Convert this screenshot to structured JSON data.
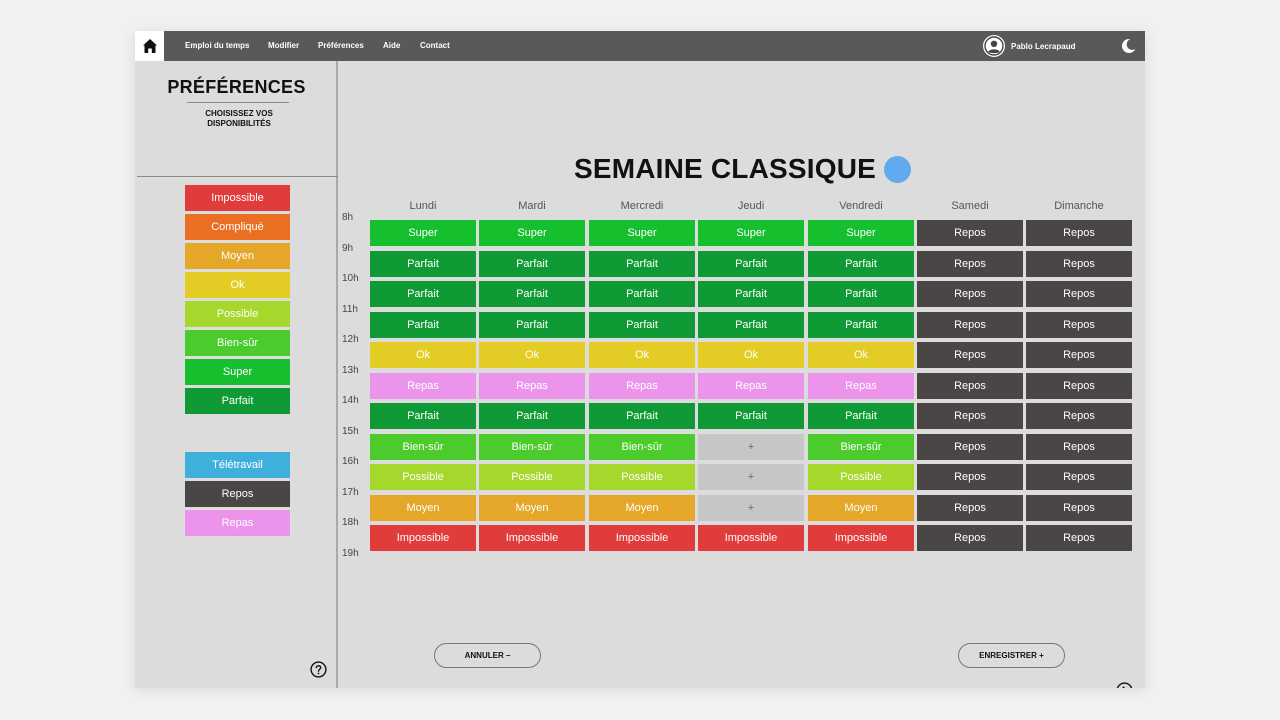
{
  "nav": {
    "links": [
      "Emploi du temps",
      "Modifier",
      "Préférences",
      "Aide",
      "Contact"
    ],
    "user_name": "Pablo Lecrapaud"
  },
  "sidebar": {
    "title": "PRÉFÉRENCES",
    "subtitle": "CHOISISSEZ VOS DISPONIBILITÉS",
    "levels": [
      {
        "label": "Impossible",
        "color": "#e03c3c"
      },
      {
        "label": "Compliqué",
        "color": "#ea6f23"
      },
      {
        "label": "Moyen",
        "color": "#e4a72a"
      },
      {
        "label": "Ok",
        "color": "#e3cd25"
      },
      {
        "label": "Possible",
        "color": "#a6d72d"
      },
      {
        "label": "Bien-sûr",
        "color": "#4ccc2c"
      },
      {
        "label": "Super",
        "color": "#15bf2e"
      },
      {
        "label": "Parfait",
        "color": "#0f9a35"
      }
    ],
    "special": [
      {
        "label": "Télétravail",
        "color": "#3fb0dc"
      },
      {
        "label": "Repos",
        "color": "#4a4646"
      },
      {
        "label": "Repas",
        "color": "#ec93ec"
      }
    ]
  },
  "week": {
    "title": "SEMAINE CLASSIQUE",
    "days": [
      "Lundi",
      "Mardi",
      "Mercredi",
      "Jeudi",
      "Vendredi",
      "Samedi",
      "Dimanche"
    ],
    "hours": [
      "8h",
      "9h",
      "10h",
      "11h",
      "12h",
      "13h",
      "14h",
      "15h",
      "16h",
      "17h",
      "18h",
      "19h"
    ],
    "colors": {
      "Super": "#15bf2e",
      "Parfait": "#0f9a35",
      "Ok": "#e3cd25",
      "Repas": "#ec93ec",
      "Bien-sûr": "#4ccc2c",
      "Possible": "#a6d72d",
      "Moyen": "#e4a72a",
      "Impossible": "#e03c3c",
      "Repos": "#4a4646",
      "+": "#c6c6c6"
    },
    "rows": [
      [
        "Super",
        "Super",
        "Super",
        "Super",
        "Super",
        "Repos",
        "Repos"
      ],
      [
        "Parfait",
        "Parfait",
        "Parfait",
        "Parfait",
        "Parfait",
        "Repos",
        "Repos"
      ],
      [
        "Parfait",
        "Parfait",
        "Parfait",
        "Parfait",
        "Parfait",
        "Repos",
        "Repos"
      ],
      [
        "Parfait",
        "Parfait",
        "Parfait",
        "Parfait",
        "Parfait",
        "Repos",
        "Repos"
      ],
      [
        "Ok",
        "Ok",
        "Ok",
        "Ok",
        "Ok",
        "Repos",
        "Repos"
      ],
      [
        "Repas",
        "Repas",
        "Repas",
        "Repas",
        "Repas",
        "Repos",
        "Repos"
      ],
      [
        "Parfait",
        "Parfait",
        "Parfait",
        "Parfait",
        "Parfait",
        "Repos",
        "Repos"
      ],
      [
        "Bien-sûr",
        "Bien-sûr",
        "Bien-sûr",
        "+",
        "Bien-sûr",
        "Repos",
        "Repos"
      ],
      [
        "Possible",
        "Possible",
        "Possible",
        "+",
        "Possible",
        "Repos",
        "Repos"
      ],
      [
        "Moyen",
        "Moyen",
        "Moyen",
        "+",
        "Moyen",
        "Repos",
        "Repos"
      ],
      [
        "Impossible",
        "Impossible",
        "Impossible",
        "Impossible",
        "Impossible",
        "Repos",
        "Repos"
      ]
    ]
  },
  "actions": {
    "cancel_label": "ANNULER –",
    "save_label": "ENREGISTRER +"
  }
}
